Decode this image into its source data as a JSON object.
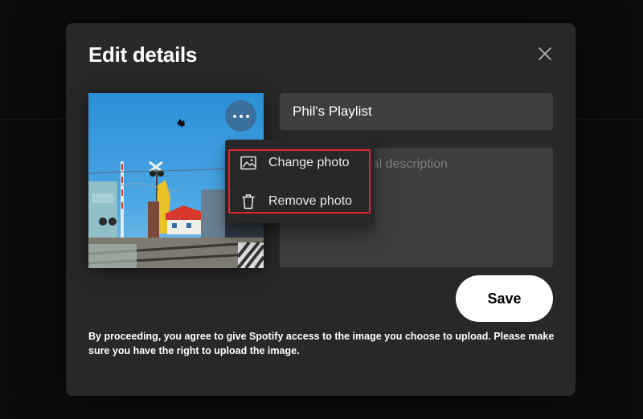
{
  "modal": {
    "title": "Edit details",
    "close_icon": "close-icon"
  },
  "cover": {
    "more_icon": "more-horizontal-icon"
  },
  "name_field": {
    "value": "Phil's Playlist"
  },
  "description_field": {
    "placeholder": "Add an optional description",
    "value": ""
  },
  "menu": {
    "items": [
      {
        "label": "Change photo",
        "icon": "image-icon"
      },
      {
        "label": "Remove photo",
        "icon": "trash-icon"
      }
    ],
    "highlight_color": "#e0282e"
  },
  "save_button": {
    "label": "Save"
  },
  "disclaimer": "By proceeding, you agree to give Spotify access to the image you choose to upload. Please make sure you have the right to upload the image.",
  "colors": {
    "modal_bg": "#282828",
    "input_bg": "#3e3e3e",
    "save_bg": "#ffffff"
  }
}
